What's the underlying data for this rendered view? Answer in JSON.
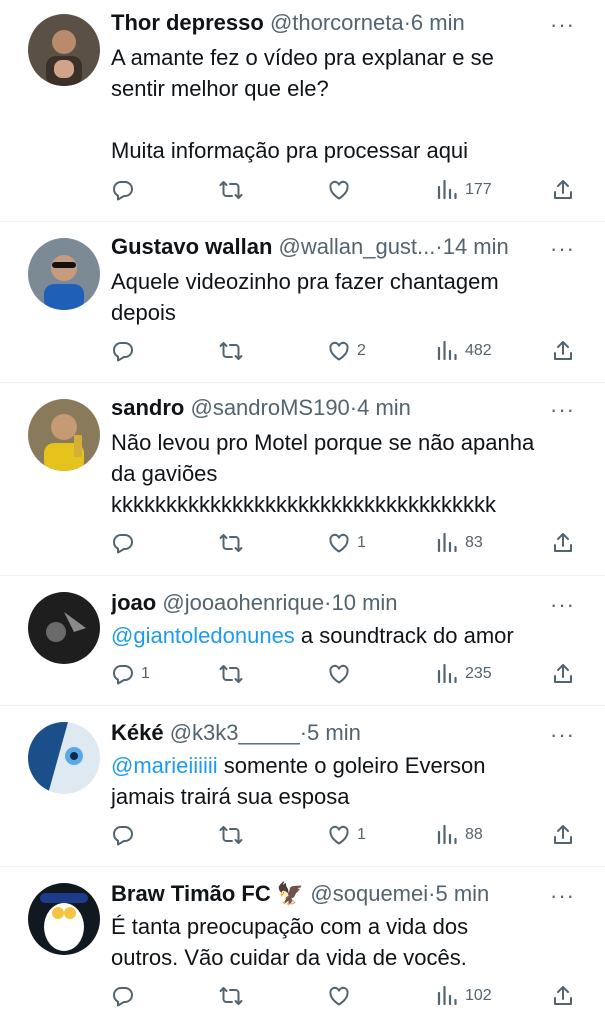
{
  "tweets": [
    {
      "name": "Thor depresso",
      "handle": "@thorcorneta",
      "time": "6 min",
      "text": "A amante fez o vídeo pra explanar e se\nsentir melhor que ele?\n\nMuita informação pra processar aqui",
      "reply_count": "",
      "retweet_count": "",
      "like_count": "",
      "view_count": "177"
    },
    {
      "name": "Gustavo wallan",
      "handle": "@wallan_gust...",
      "time": "14 min",
      "text": "Aquele videozinho pra fazer chantagem\ndepois",
      "reply_count": "",
      "retweet_count": "",
      "like_count": "2",
      "view_count": "482"
    },
    {
      "name": "sandro",
      "handle": "@sandroMS190",
      "time": "4 min",
      "text": "Não levou pro Motel porque se não apanha\nda gaviões\nkkkkkkkkkkkkkkkkkkkkkkkkkkkkkkkkkkk",
      "reply_count": "",
      "retweet_count": "",
      "like_count": "1",
      "view_count": "83"
    },
    {
      "name": "joao",
      "handle": "@jooaohenrique",
      "time": "10 min",
      "mention": "@giantoledonunes",
      "text": " a soundtrack do amor",
      "reply_count": "1",
      "retweet_count": "",
      "like_count": "",
      "view_count": "235"
    },
    {
      "name": "Kéké",
      "handle": "@k3k3_____",
      "time": "5 min",
      "mention": "@marieiiiiii",
      "text": " somente o goleiro Everson\njamais trairá sua esposa",
      "reply_count": "",
      "retweet_count": "",
      "like_count": "1",
      "view_count": "88"
    },
    {
      "name": "Braw Timão FC",
      "name_emoji": "🦅",
      "handle": "@soquemei",
      "time": "5 min",
      "text": "É tanta preocupação com a vida dos\noutros. Vão cuidar da vida de vocês.",
      "reply_count": "",
      "retweet_count": "",
      "like_count": "",
      "view_count": "102"
    }
  ],
  "separator": "·",
  "more_icon": "more-dots-icon",
  "colors": {
    "link": "#1d9bf0",
    "muted": "#536471",
    "text": "#0f1419"
  }
}
